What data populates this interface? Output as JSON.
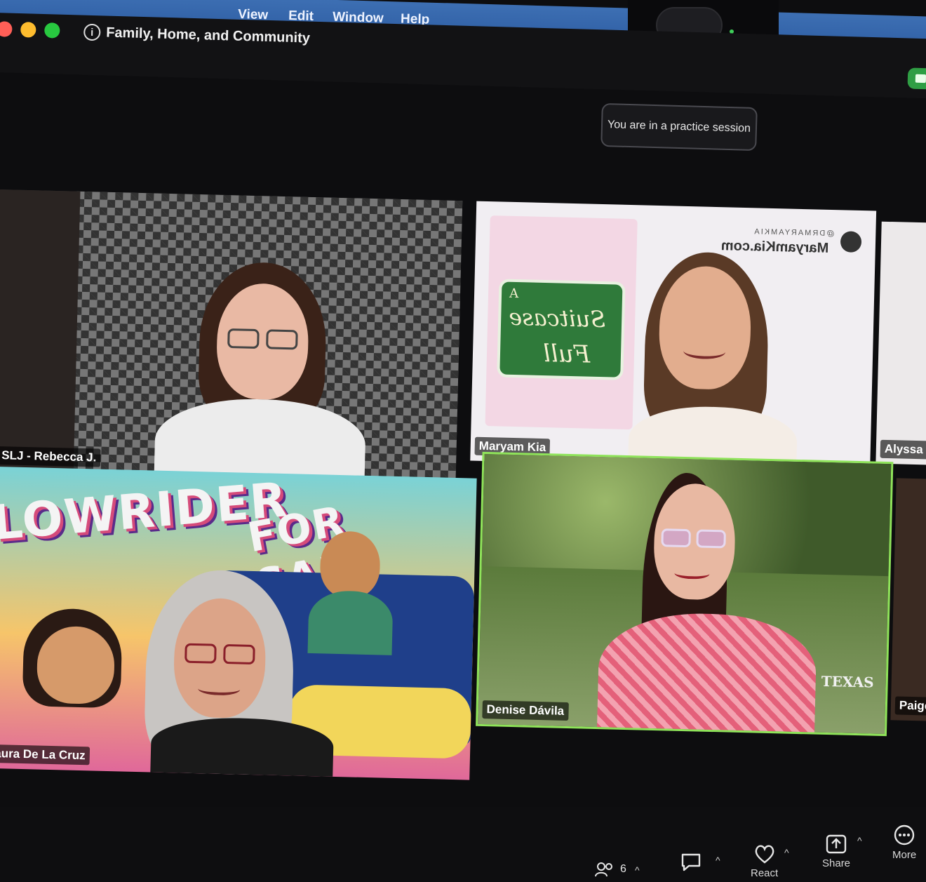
{
  "menubar": {
    "items": [
      "View",
      "Edit",
      "Window",
      "Help"
    ]
  },
  "window": {
    "title": "Family, Home, and Community"
  },
  "banner": {
    "practice_text": "You are in a practice session"
  },
  "gallery": {
    "tiles": [
      {
        "name": "SLJ - Rebecca J."
      },
      {
        "name": "Maryam Kia",
        "website": "MaryamKia.com",
        "handle": "@DRMARYAMKIA",
        "book_title_line1": "A",
        "book_title_line2": "Suitcase",
        "book_title_line3": "Full"
      },
      {
        "name": "Alyssa Ra"
      },
      {
        "name": "Laura De La Cruz",
        "book_title_line1": "LOWRIDER",
        "book_title_line2": "FOR SALE"
      },
      {
        "name": "Denise Dávila",
        "logo_text": "TEXAS",
        "active": true
      },
      {
        "name": "Paige"
      }
    ]
  },
  "toolbar": {
    "participants_count": "6",
    "react_label": "React",
    "share_label": "Share",
    "more_label": "More"
  },
  "colors": {
    "menubar": "#2b5aa0",
    "active_speaker": "#8fe35a",
    "video_on": "#2f9e44"
  }
}
